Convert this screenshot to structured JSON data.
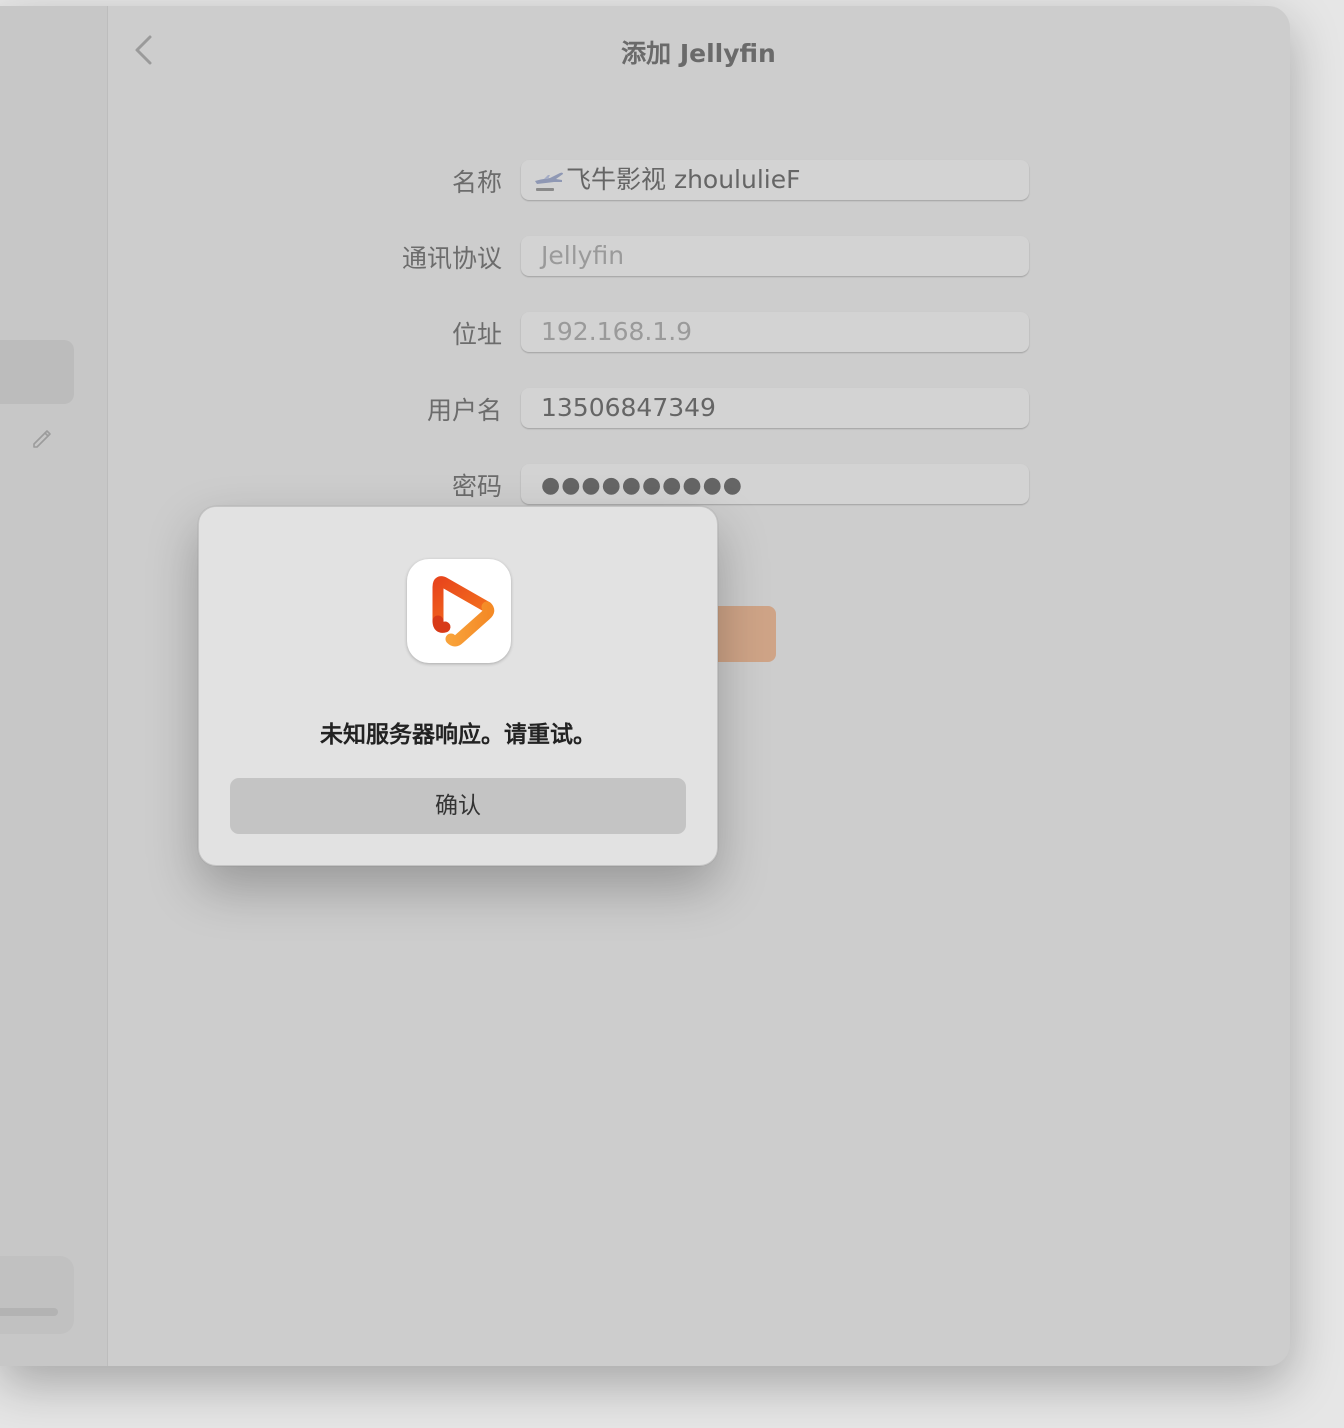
{
  "window": {
    "title": "添加 Jellyfin"
  },
  "form": {
    "name": {
      "label": "名称",
      "value": "飞牛影视 zhoululieF"
    },
    "protocol": {
      "label": "通讯协议",
      "value": "Jellyfin"
    },
    "address": {
      "label": "位址",
      "value": "192.168.1.9"
    },
    "username": {
      "label": "用户名",
      "value": "13506847349"
    },
    "password": {
      "label": "密码",
      "value": "●●●●●●●●●●"
    }
  },
  "dialog": {
    "message": "未知服务器响应。请重试。",
    "confirm_label": "确认"
  },
  "colors": {
    "accent": "#cfa487",
    "brand_orange": "#f07a1e",
    "brand_red": "#e84a1c"
  }
}
